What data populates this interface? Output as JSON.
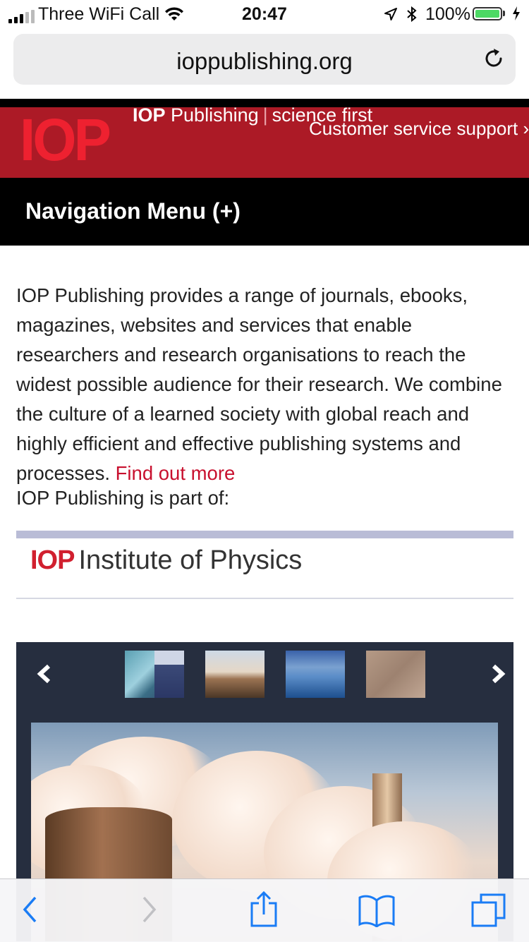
{
  "status_bar": {
    "carrier": "Three WiFi Call",
    "time": "20:47",
    "battery_percent": "100%",
    "battery_level": 1.0,
    "charging": true,
    "signal_bars": 3,
    "signal_total": 5
  },
  "address_bar": {
    "url": "ioppublishing.org"
  },
  "site_header": {
    "logo": "IOP",
    "brand": "IOP",
    "brand_rest": "Publishing",
    "tagline": "science first",
    "customer_link": "Customer service support ›",
    "brand_color": "#ac1a26"
  },
  "nav": {
    "label": "Navigation Menu (+)"
  },
  "content": {
    "intro": "IOP Publishing provides a range of journals, ebooks, magazines, websites and services that enable researchers and research organisations to reach the widest possible audience for their research. We combine the culture of a learned society with global reach and highly efficient and effective publishing systems and processes.",
    "find_out_more": "Find out more",
    "part_of": "IOP Publishing is part of:",
    "partner_logo_mark": "IOP",
    "partner_logo_text": "Institute of Physics"
  },
  "carousel": {
    "prev_icon": "chevron-left-icon",
    "next_icon": "chevron-right-icon",
    "thumbnails": [
      "journal-covers",
      "power-plant",
      "icebergs",
      "skin-texture"
    ],
    "main_image": "power-plant"
  },
  "toolbar": {
    "icons": [
      "back-icon",
      "forward-icon",
      "share-icon",
      "bookmarks-icon",
      "tabs-icon"
    ],
    "accent": "#1a7cf5"
  }
}
